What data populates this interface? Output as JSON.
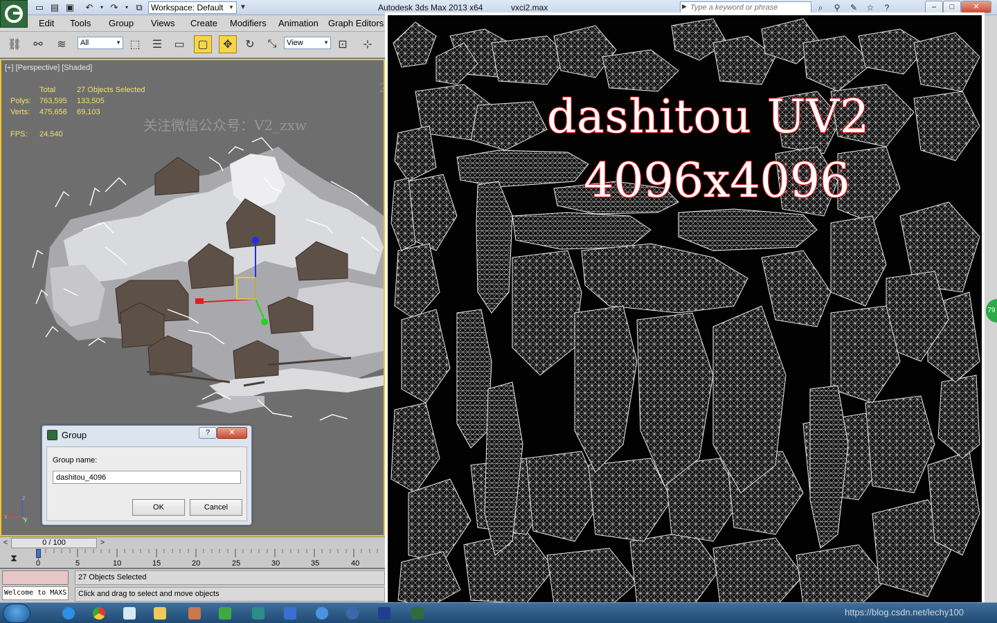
{
  "app": {
    "title": "Autodesk 3ds Max  2013 x64",
    "file": "vxci2.max",
    "workspace": "Workspace: Default",
    "search_placeholder": "Type a keyword or phrase"
  },
  "menu": [
    "Edit",
    "Tools",
    "Group",
    "Views",
    "Create",
    "Modifiers",
    "Animation",
    "Graph Editors"
  ],
  "toolbar": {
    "selection_filter": "All",
    "ref_coord": "View"
  },
  "viewport": {
    "label": "[+] [Perspective] [Shaded]",
    "stats": {
      "header_total": "Total",
      "header_selected": "27 Objects Selected",
      "polys_label": "Polys:",
      "polys_total": "763,595",
      "polys_selected": "133,505",
      "verts_label": "Verts:",
      "verts_total": "475,656",
      "verts_selected": "69,103",
      "fps_label": "FPS:",
      "fps_value": "24.540"
    },
    "watermark": "关注微信公众号：V2_zxw",
    "watermark2": "2_zxw",
    "axis": {
      "x": "x",
      "y": "y",
      "z": "z"
    }
  },
  "dialog": {
    "title": "Group",
    "help": "?",
    "close": "✕",
    "field_label": "Group name:",
    "field_value": "dashitou_4096",
    "ok": "OK",
    "cancel": "Cancel"
  },
  "timeline": {
    "position": "0 / 100",
    "left_arrow": "<",
    "right_arrow": ">",
    "ticks": [
      "0",
      "5",
      "10",
      "15",
      "20",
      "25",
      "30",
      "35",
      "40"
    ]
  },
  "status": {
    "selection": "27 Objects Selected",
    "prompt": "Click and drag to select and move objects",
    "maxscript": "Welcome to MAXS"
  },
  "uv": {
    "title": "dashitou UV2",
    "size": "4096x4096"
  },
  "taskbar": {
    "blog": "https://blog.csdn.net/lechy100",
    "badge": "79"
  }
}
